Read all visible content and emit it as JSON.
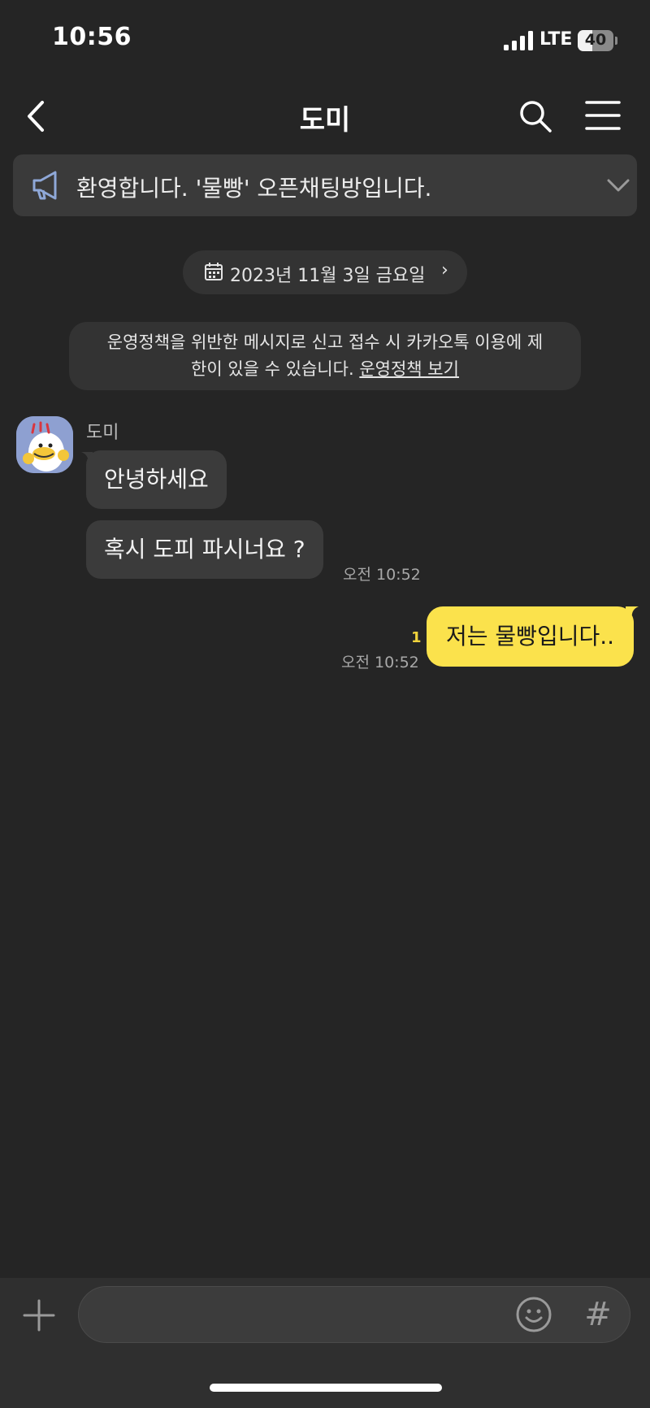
{
  "status_bar": {
    "time": "10:56",
    "network": "LTE",
    "battery": "40",
    "battery_level_percent": 40,
    "signal_icon": "signal-bars-icon"
  },
  "header": {
    "title": "도미",
    "back_icon": "chevron-left-icon",
    "search_icon": "search-icon",
    "menu_icon": "hamburger-menu-icon"
  },
  "notice": {
    "icon": "megaphone-icon",
    "text": "환영합니다. '물빵' 오픈채팅방입니다.",
    "expand_icon": "chevron-down-icon"
  },
  "date_divider": {
    "icon": "calendar-icon",
    "text": "2023년 11월 3일 금요일",
    "arrow": "›"
  },
  "policy_notice": {
    "line1": "운영정책을 위반한 메시지로 신고 접수 시 카카오톡 이용에 제",
    "line2": "한이 있을 수 있습니다.",
    "link": "운영정책 보기"
  },
  "messages": {
    "received": {
      "sender": "도미",
      "avatar": "profile-avatar",
      "items": [
        "안녕하세요",
        "혹시 도피 파시너요 ?"
      ],
      "time": "오전 10:52"
    },
    "sent": {
      "text": "저는 물빵입니다..",
      "unread_count": "1",
      "time": "오전 10:52"
    }
  },
  "input_bar": {
    "plus_icon": "plus-icon",
    "emoji_icon": "emoji-icon",
    "hash": "#",
    "message_value": ""
  },
  "colors": {
    "background": "#252525",
    "sent_bubble": "#fbe24c",
    "received_bubble": "#3b3b3b",
    "unread": "#f0d33c"
  }
}
